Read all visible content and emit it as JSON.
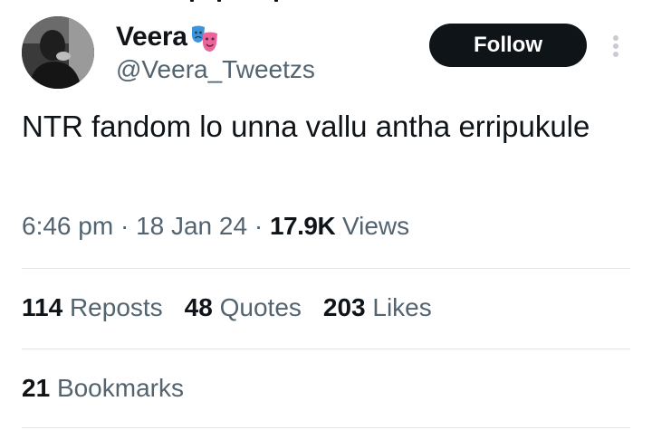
{
  "user": {
    "display_name": "Veera",
    "handle": "@Veera_Tweetzs",
    "name_emoji": "performing-arts-masks-icon"
  },
  "actions": {
    "follow_label": "Follow",
    "more_icon": "more-vertical-icon"
  },
  "tweet": {
    "text": "NTR fandom lo unna vallu antha erripukule"
  },
  "meta": {
    "time": "6:46 pm",
    "sep1": " · ",
    "date": "18 Jan 24",
    "sep2": " · ",
    "views_count": "17.9K",
    "views_label": "Views"
  },
  "stats": {
    "reposts_count": "114",
    "reposts_label": "Reposts",
    "quotes_count": "48",
    "quotes_label": "Quotes",
    "likes_count": "203",
    "likes_label": "Likes",
    "bookmarks_count": "21",
    "bookmarks_label": "Bookmarks"
  },
  "colors": {
    "text_primary": "#0f1419",
    "text_secondary": "#536471",
    "divider": "#e1e5e8",
    "button_bg": "#0f1419"
  }
}
